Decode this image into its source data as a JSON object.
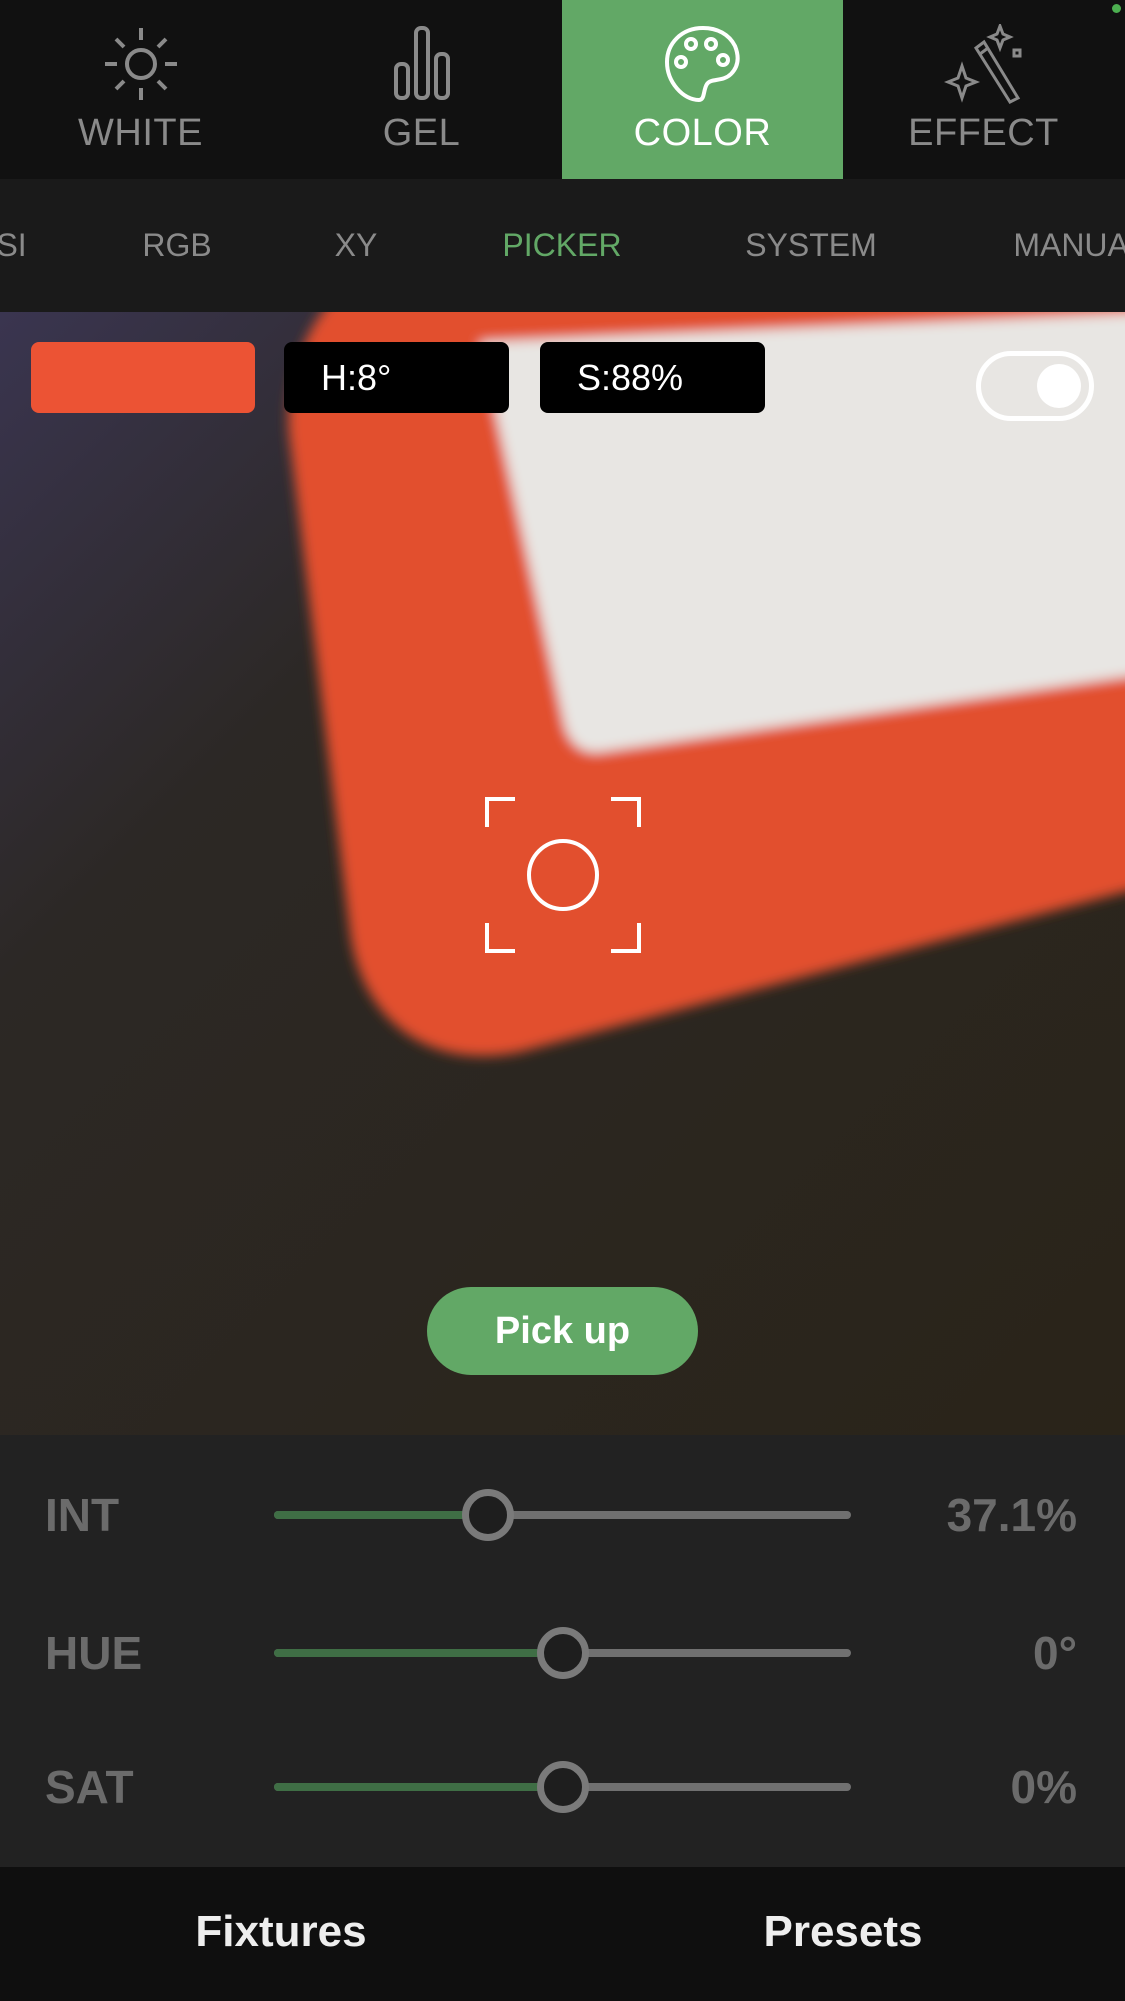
{
  "modes": [
    {
      "label": "WHITE",
      "icon": "sun-icon"
    },
    {
      "label": "GEL",
      "icon": "bars-icon"
    },
    {
      "label": "COLOR",
      "icon": "palette-icon",
      "active": true
    },
    {
      "label": "EFFECT",
      "icon": "magic-wand-icon"
    }
  ],
  "subtabs": [
    {
      "label": "HSI"
    },
    {
      "label": "RGB"
    },
    {
      "label": "XY"
    },
    {
      "label": "PICKER",
      "active": true
    },
    {
      "label": "SYSTEM"
    },
    {
      "label": "MANUAL"
    }
  ],
  "picker": {
    "swatch_color": "#ec5334",
    "hue": "H:8°",
    "saturation": "S:88%",
    "toggle_on": true,
    "pick_label": "Pick up"
  },
  "sliders": [
    {
      "label": "INT",
      "value": "37.1%",
      "fraction": 0.371
    },
    {
      "label": "HUE",
      "value": "0°",
      "fraction": 0.5
    },
    {
      "label": "SAT",
      "value": "0%",
      "fraction": 0.5
    }
  ],
  "bottom_nav": [
    {
      "label": "Fixtures"
    },
    {
      "label": "Presets"
    }
  ],
  "colors": {
    "accent": "#62a866"
  }
}
